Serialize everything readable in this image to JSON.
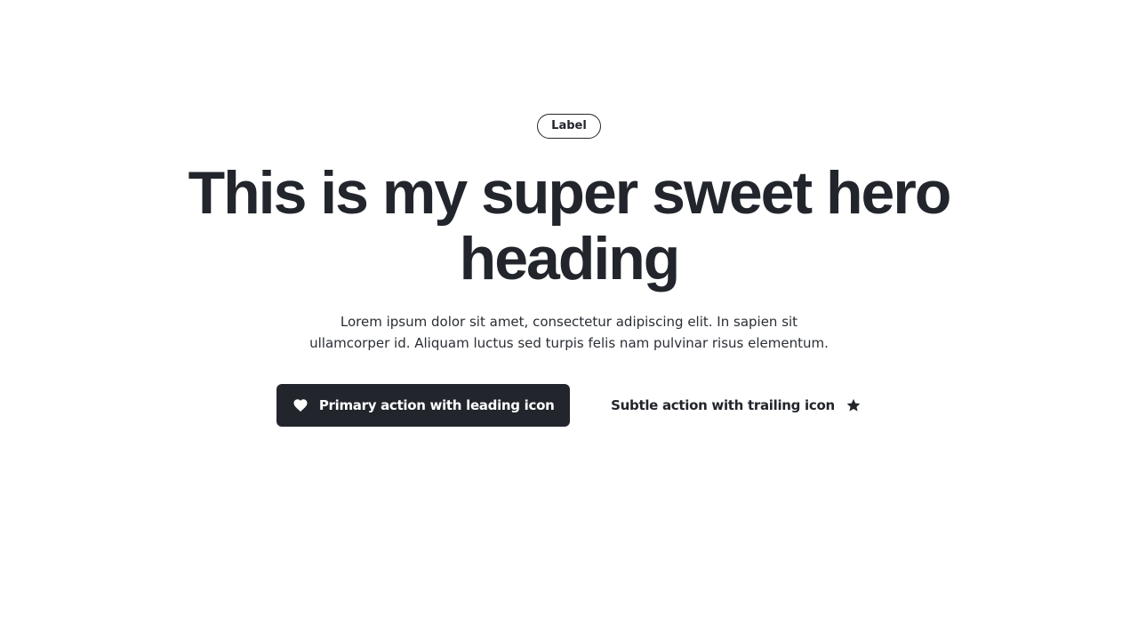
{
  "hero": {
    "label": "Label",
    "heading": "This is my super sweet hero heading",
    "subtext": "Lorem ipsum dolor sit amet, consectetur adipiscing elit. In sapien sit ullamcorper id. Aliquam luctus sed turpis felis nam pulvinar risus elementum."
  },
  "actions": {
    "primary": {
      "label": "Primary action with leading icon",
      "icon": "heart-icon"
    },
    "subtle": {
      "label": "Subtle action with trailing icon",
      "icon": "star-icon"
    }
  },
  "colors": {
    "text": "#22262c",
    "primary_bg": "#22262c",
    "primary_text": "#ffffff",
    "background": "#ffffff"
  }
}
